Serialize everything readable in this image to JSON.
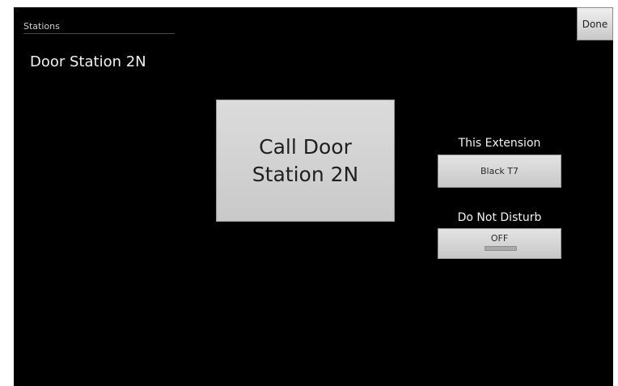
{
  "sidebar": {
    "header": "Stations",
    "items": [
      {
        "label": "Door Station 2N"
      }
    ]
  },
  "toolbar": {
    "done_label": "Done"
  },
  "main": {
    "call_button_label": "Call Door\nStation 2N"
  },
  "extension": {
    "label": "This Extension",
    "value": "Black T7"
  },
  "dnd": {
    "label": "Do Not Disturb",
    "state": "OFF",
    "indicator_color": "#a9a9a9"
  }
}
